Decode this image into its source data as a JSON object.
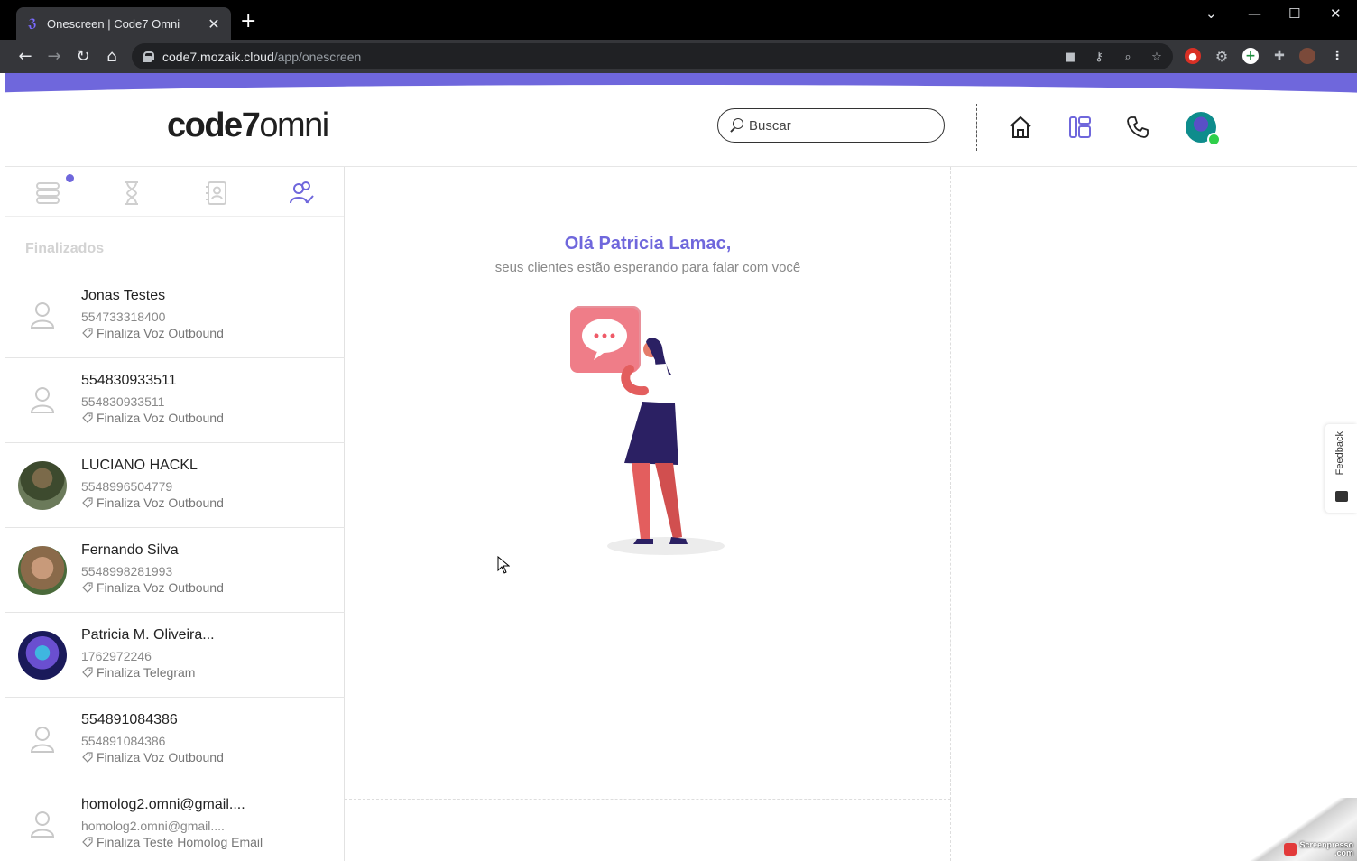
{
  "browser": {
    "tab_title": "Onescreen | Code7 Omni",
    "tab_close": "✕",
    "new_tab": "+",
    "url_host": "code7.mozaik.cloud",
    "url_path": "/app/onescreen",
    "window_controls": [
      "minimize",
      "maximize",
      "close"
    ]
  },
  "header": {
    "logo_bold": "code7",
    "logo_light": "omni",
    "search_placeholder": "Buscar",
    "icons": [
      "home-icon",
      "dashboard-icon",
      "phone-icon",
      "user-avatar"
    ]
  },
  "sidebar": {
    "tabs": [
      "stack-icon",
      "hourglass-icon",
      "contacts-book-icon",
      "users-check-icon"
    ],
    "active_tab": "users-check-icon",
    "section_title": "Finalizados",
    "items": [
      {
        "name": "Jonas Testes",
        "phone": "554733318400",
        "tag": "Finaliza Voz Outbound",
        "avatar": "placeholder"
      },
      {
        "name": "554830933511",
        "phone": "554830933511",
        "tag": "Finaliza Voz Outbound",
        "avatar": "placeholder"
      },
      {
        "name": "LUCIANO HACKL",
        "phone": "5548996504779",
        "tag": "Finaliza Voz Outbound",
        "avatar": "photo"
      },
      {
        "name": "Fernando Silva",
        "phone": "5548998281993",
        "tag": "Finaliza Voz Outbound",
        "avatar": "photo"
      },
      {
        "name": "Patricia M. Oliveira...",
        "phone": "1762972246",
        "tag": "Finaliza Telegram",
        "avatar": "photo"
      },
      {
        "name": "554891084386",
        "phone": "554891084386",
        "tag": "Finaliza Voz Outbound",
        "avatar": "placeholder"
      },
      {
        "name": "homolog2.omni@gmail....",
        "phone": "homolog2.omni@gmail....",
        "tag": "Finaliza Teste Homolog Email",
        "avatar": "placeholder"
      }
    ]
  },
  "center": {
    "greeting": "Olá Patricia Lamac,",
    "subtitle": "seus clientes estão esperando para falar com você"
  },
  "feedback": {
    "label": "Feedback"
  },
  "watermark": {
    "line1": "Screenpresso",
    "line2": ".com"
  },
  "colors": {
    "accent": "#6f67dc",
    "online": "#2fcf4a"
  }
}
